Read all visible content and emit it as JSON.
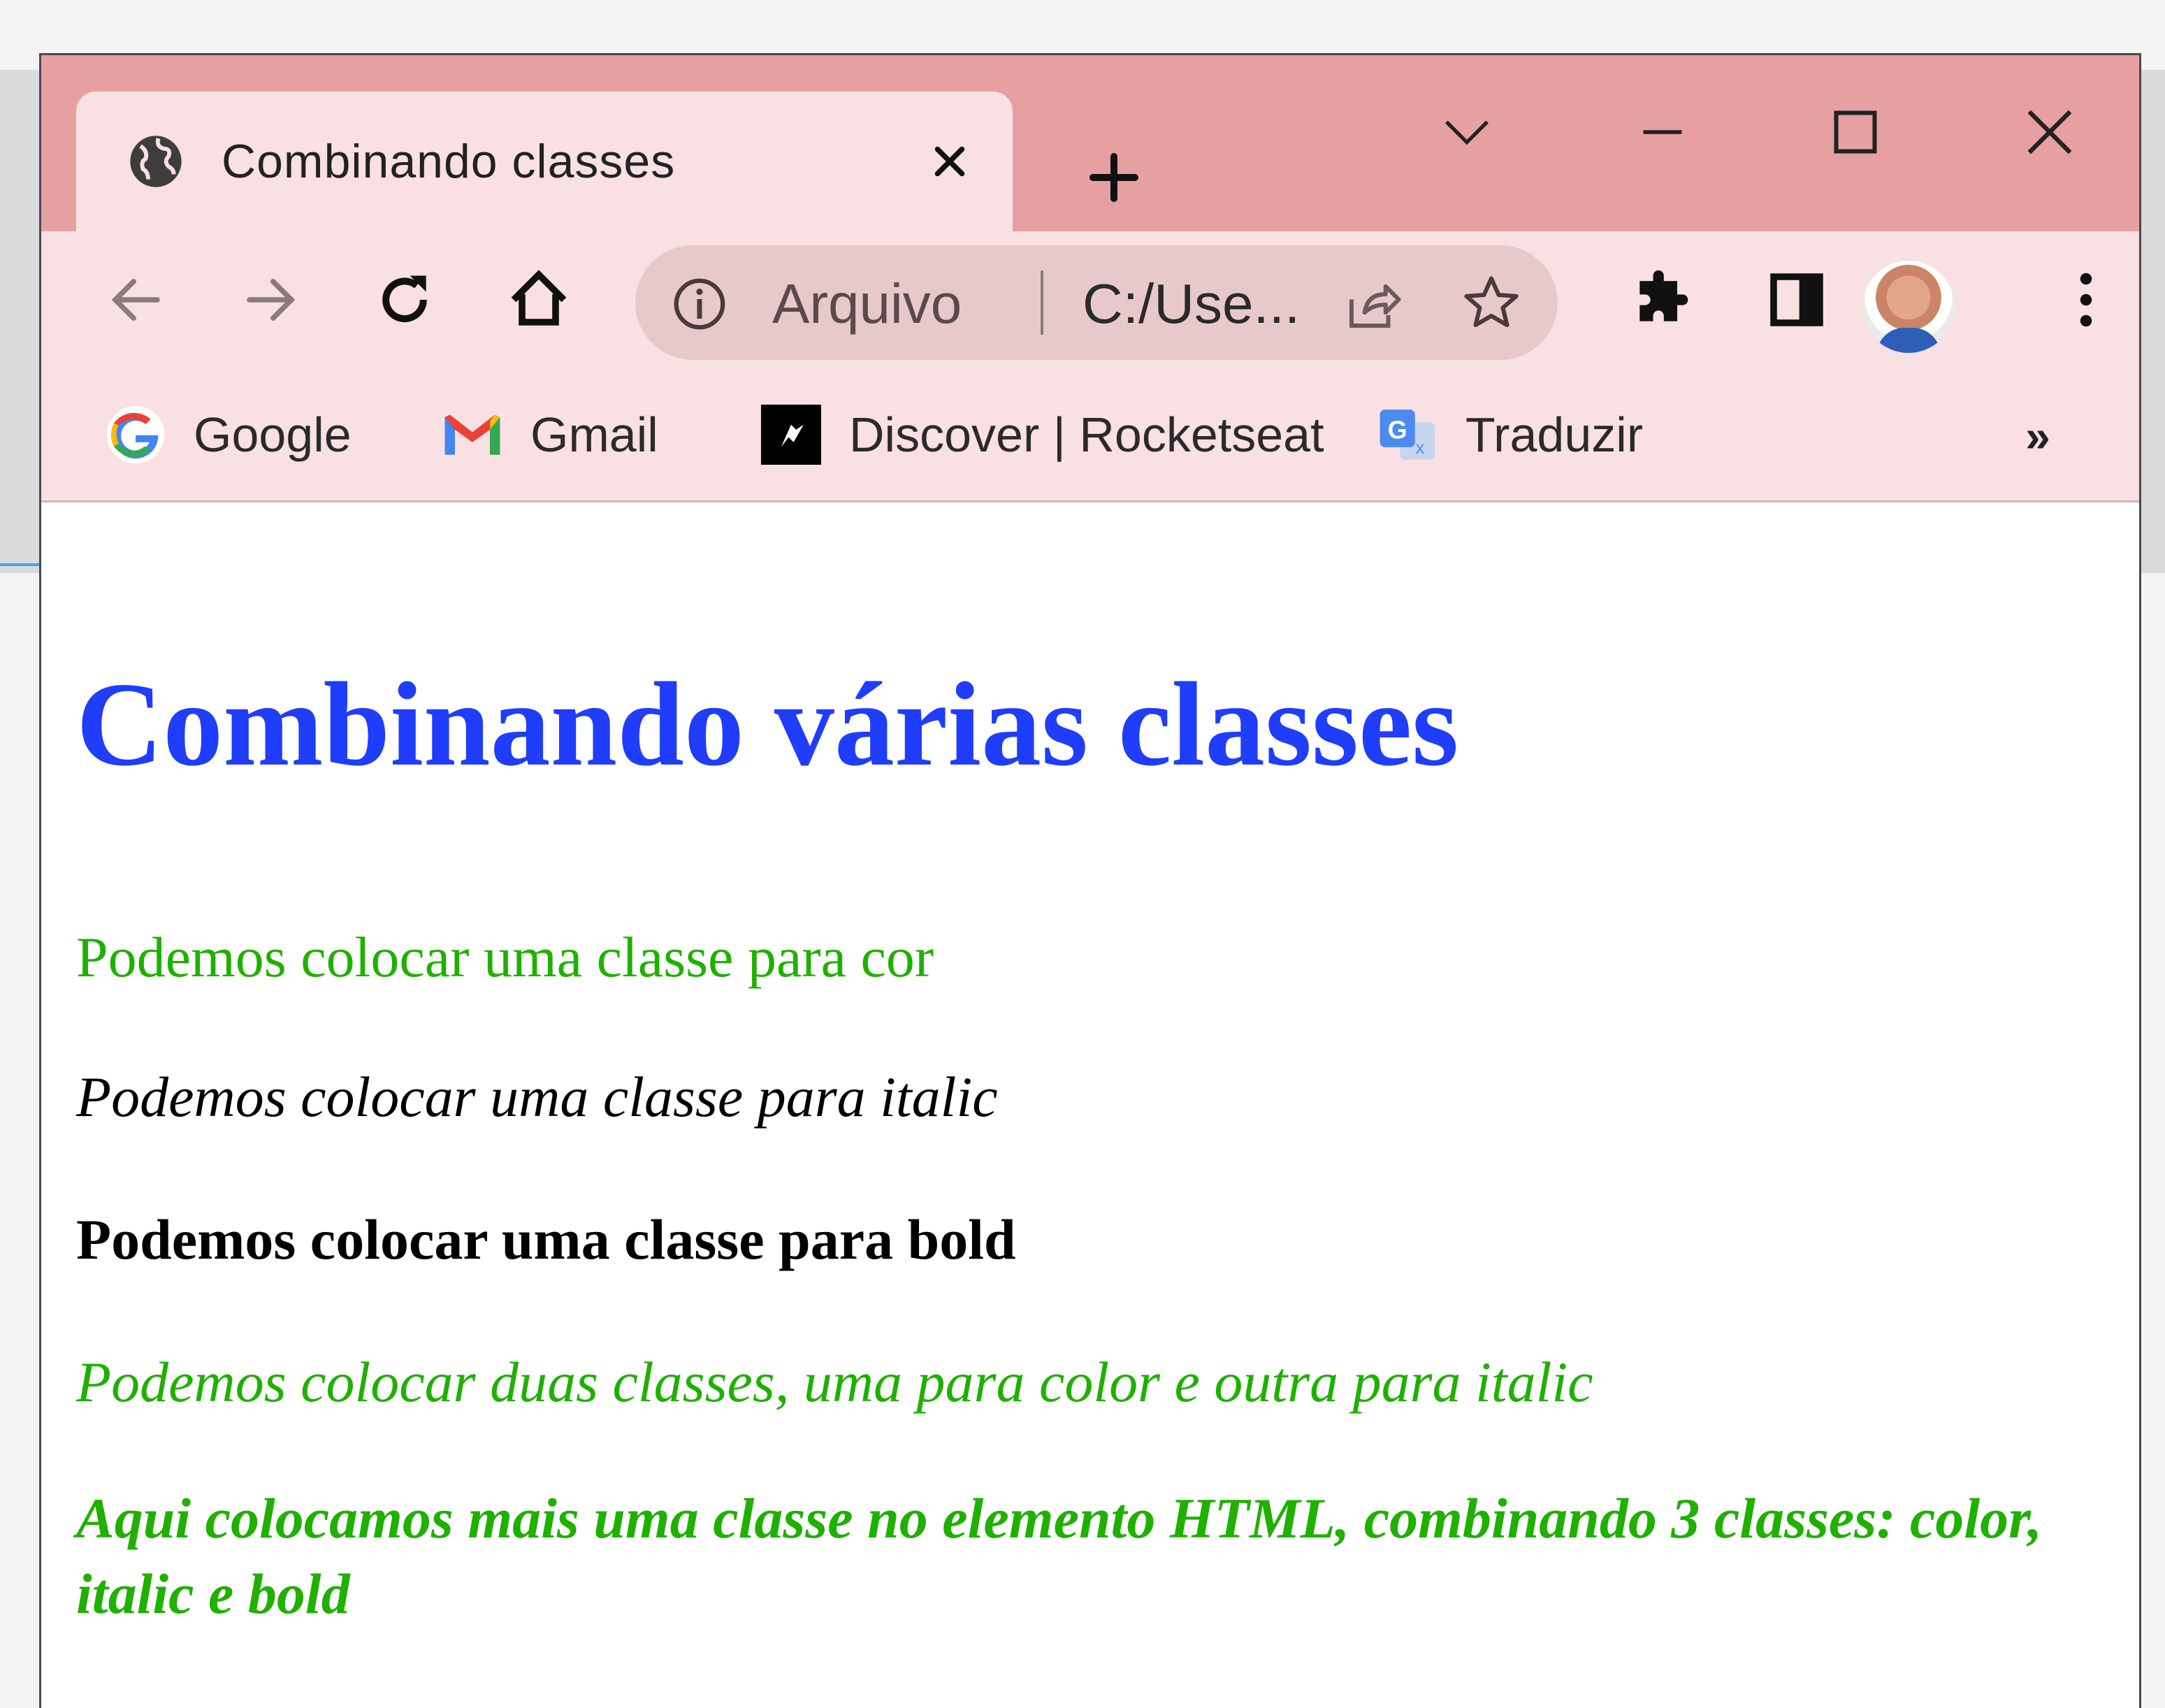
{
  "window": {
    "tab_title": "Combinando classes",
    "new_tab_symbol": "+",
    "controls": [
      "tab-search",
      "minimize",
      "maximize",
      "close"
    ]
  },
  "toolbar": {
    "scheme_label": "Arquivo",
    "url": "C:/Use...",
    "icons": [
      "back-arrow-icon",
      "forward-arrow-icon",
      "reload-icon",
      "home-icon",
      "info-icon",
      "share-icon",
      "star-icon",
      "extensions-icon",
      "side-panel-icon",
      "avatar",
      "menu-icon"
    ]
  },
  "bookmarks": {
    "items": [
      {
        "label": "Google",
        "icon": "google-icon"
      },
      {
        "label": "Gmail",
        "icon": "gmail-icon"
      },
      {
        "label": "Discover | Rocketseat",
        "icon": "rocketseat-icon"
      },
      {
        "label": "Traduzir",
        "icon": "translate-icon"
      }
    ],
    "overflow_symbol": "»"
  },
  "page": {
    "heading": "Combinando várias classes",
    "paragraphs": [
      "Podemos colocar uma classe para cor",
      "Podemos colocar uma classe para italic",
      "Podemos colocar uma classe para bold",
      "Podemos colocar duas classes, uma para color e outra para italic",
      "Aqui colocamos mais uma classe no elemento HTML, combinando 3 classes: color, italic e bold"
    ]
  },
  "colors": {
    "titlebar": "#e6a0a1",
    "toolbar": "#f9e0e2",
    "heading": "#1f3dfb",
    "green_text": "#1fb000"
  }
}
